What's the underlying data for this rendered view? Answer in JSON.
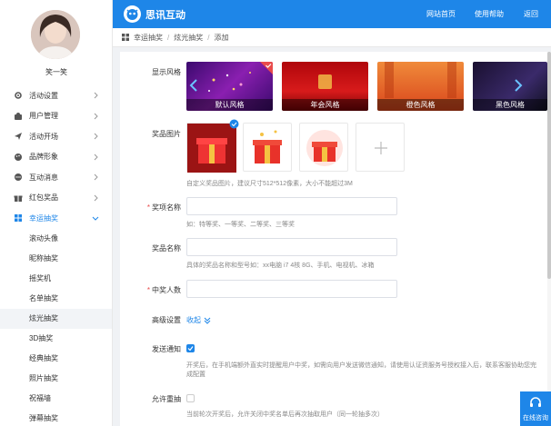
{
  "header": {
    "brand": "思讯互动",
    "nav": [
      "网站首页",
      "使用帮助",
      "返回"
    ]
  },
  "user": {
    "name": "笑一笑"
  },
  "sidebar": {
    "items": [
      {
        "label": "活动设置",
        "icon": "gear-icon"
      },
      {
        "label": "用户管理",
        "icon": "user-icon"
      },
      {
        "label": "活动开场",
        "icon": "send-icon"
      },
      {
        "label": "品牌形象",
        "icon": "palette-icon"
      },
      {
        "label": "互动消息",
        "icon": "chat-icon"
      },
      {
        "label": "红包奖品",
        "icon": "gift-icon"
      },
      {
        "label": "幸运抽奖",
        "icon": "grid-icon"
      }
    ],
    "subitems": [
      "滚动头像",
      "昵称抽奖",
      "摇奖机",
      "名单抽奖",
      "炫光抽奖",
      "3D抽奖",
      "经典抽奖",
      "照片抽奖",
      "祝福墙",
      "弹幕抽奖"
    ]
  },
  "breadcrumb": [
    "幸运抽奖",
    "炫光抽奖",
    "添加"
  ],
  "form": {
    "style_label": "显示风格",
    "styles": [
      "默认风格",
      "年会风格",
      "橙色风格",
      "黑色风格"
    ],
    "prize_image_label": "奖品图片",
    "prize_image_hint": "自定义奖品图片，建议尺寸512*512像素，大小不能超过3M",
    "award_name_label": "奖项名称",
    "award_name_hint": "如：特等奖、一等奖、二等奖、三等奖",
    "prize_name_label": "奖品名称",
    "prize_name_hint": "具体的奖品名称和型号如：xx电脑 i7 4核 8G、手机、电视机、冰箱",
    "winners_label": "中奖人数",
    "advanced_label": "高级设置",
    "collapse_label": "收起",
    "notify_label": "发送通知",
    "notify_hint_1": "开奖后，在手机端额外直实时提醒用户中奖，如需向用户发送微信通知，请使用认证资服务号授权接入后，联系客服协助您完",
    "notify_hint_2": "成配置",
    "repeat_label": "允许重抽",
    "repeat_hint": "当前轮次开奖后，允许关闭中奖名单后再次抽取用户（同一轮抽多次）"
  },
  "service": {
    "label": "在线咨询"
  },
  "colors": {
    "accent": "#1e86e8",
    "required": "#e94b4b"
  }
}
